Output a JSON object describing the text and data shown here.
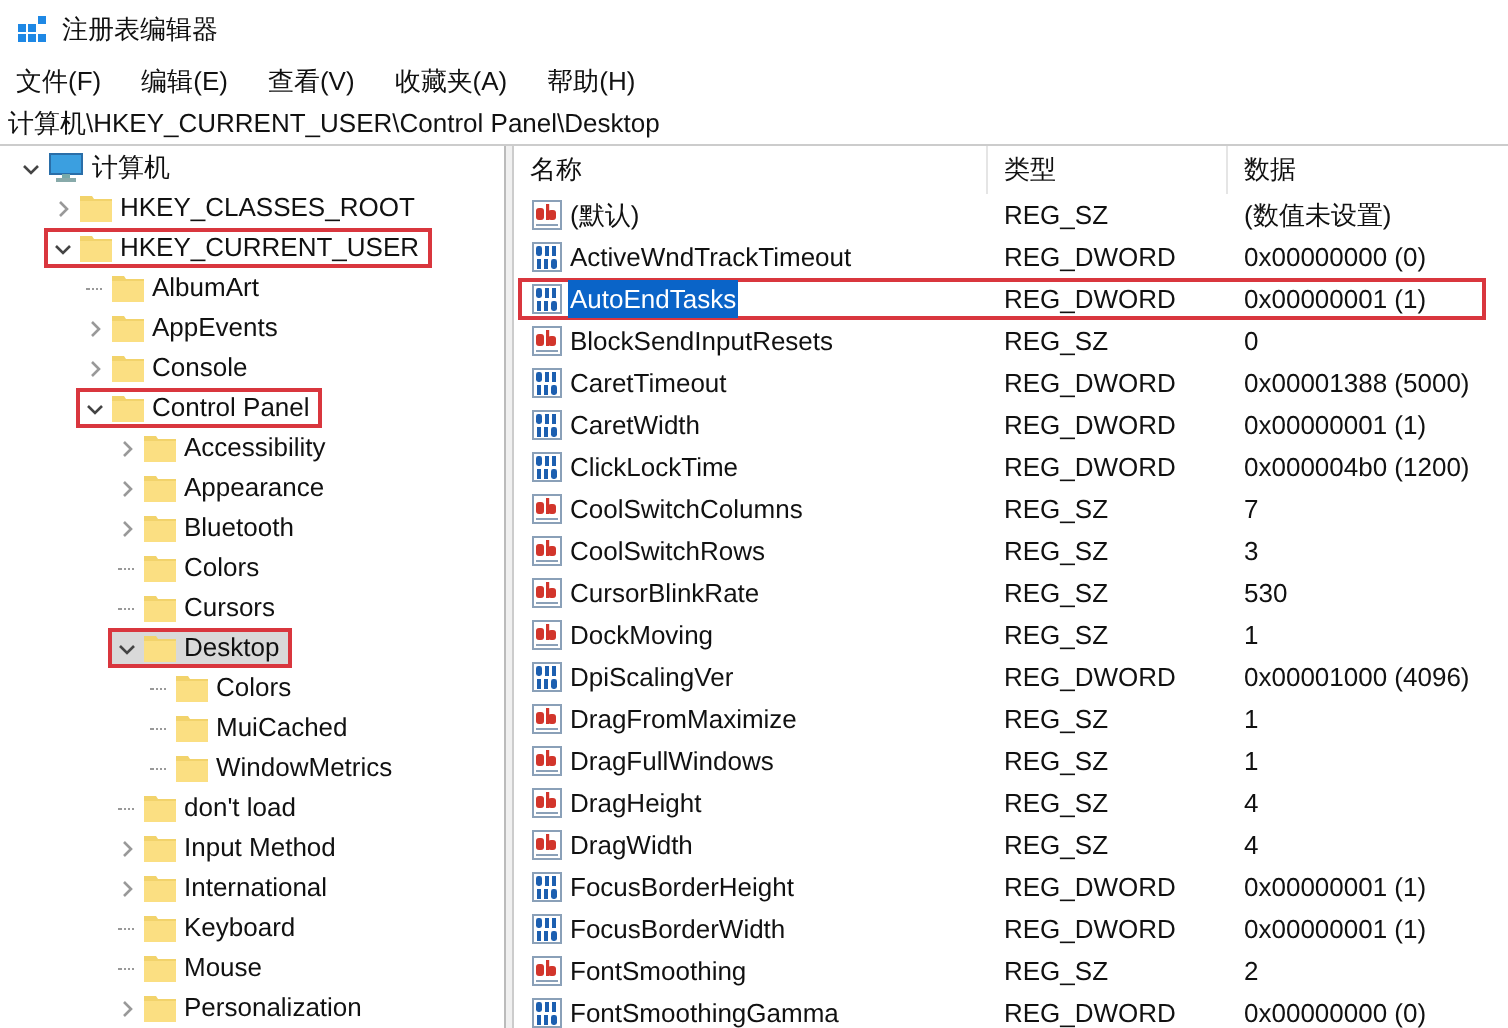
{
  "window": {
    "title": "注册表编辑器"
  },
  "menu": [
    "文件(F)",
    "编辑(E)",
    "查看(V)",
    "收藏夹(A)",
    "帮助(H)"
  ],
  "address": "计算机\\HKEY_CURRENT_USER\\Control Panel\\Desktop",
  "tree": [
    {
      "label": "计算机",
      "kind": "computer",
      "expanded": true,
      "selected": false,
      "highlighted": false,
      "children": [
        {
          "label": "HKEY_CLASSES_ROOT",
          "kind": "branch",
          "expanded": false,
          "selected": false,
          "highlighted": false
        },
        {
          "label": "HKEY_CURRENT_USER",
          "kind": "branch",
          "expanded": true,
          "selected": false,
          "highlighted": true,
          "children": [
            {
              "label": "AlbumArt",
              "kind": "leaf",
              "selected": false,
              "highlighted": false
            },
            {
              "label": "AppEvents",
              "kind": "branch",
              "expanded": false,
              "selected": false,
              "highlighted": false
            },
            {
              "label": "Console",
              "kind": "branch",
              "expanded": false,
              "selected": false,
              "highlighted": false
            },
            {
              "label": "Control Panel",
              "kind": "branch",
              "expanded": true,
              "selected": false,
              "highlighted": true,
              "children": [
                {
                  "label": "Accessibility",
                  "kind": "branch",
                  "expanded": false,
                  "selected": false,
                  "highlighted": false
                },
                {
                  "label": "Appearance",
                  "kind": "branch",
                  "expanded": false,
                  "selected": false,
                  "highlighted": false
                },
                {
                  "label": "Bluetooth",
                  "kind": "branch",
                  "expanded": false,
                  "selected": false,
                  "highlighted": false
                },
                {
                  "label": "Colors",
                  "kind": "leaf",
                  "selected": false,
                  "highlighted": false
                },
                {
                  "label": "Cursors",
                  "kind": "leaf",
                  "selected": false,
                  "highlighted": false
                },
                {
                  "label": "Desktop",
                  "kind": "branch",
                  "expanded": true,
                  "selected": true,
                  "highlighted": true,
                  "children": [
                    {
                      "label": "Colors",
                      "kind": "leaf",
                      "selected": false,
                      "highlighted": false
                    },
                    {
                      "label": "MuiCached",
                      "kind": "leaf",
                      "selected": false,
                      "highlighted": false
                    },
                    {
                      "label": "WindowMetrics",
                      "kind": "leaf",
                      "selected": false,
                      "highlighted": false
                    }
                  ]
                },
                {
                  "label": "don't load",
                  "kind": "leaf",
                  "selected": false,
                  "highlighted": false
                },
                {
                  "label": "Input Method",
                  "kind": "branch",
                  "expanded": false,
                  "selected": false,
                  "highlighted": false
                },
                {
                  "label": "International",
                  "kind": "branch",
                  "expanded": false,
                  "selected": false,
                  "highlighted": false
                },
                {
                  "label": "Keyboard",
                  "kind": "leaf",
                  "selected": false,
                  "highlighted": false
                },
                {
                  "label": "Mouse",
                  "kind": "leaf",
                  "selected": false,
                  "highlighted": false
                },
                {
                  "label": "Personalization",
                  "kind": "branch",
                  "expanded": false,
                  "selected": false,
                  "highlighted": false
                }
              ]
            }
          ]
        }
      ]
    }
  ],
  "table": {
    "columns": [
      "名称",
      "类型",
      "数据"
    ],
    "rows": [
      {
        "kind": "sz",
        "name": "(默认)",
        "type": "REG_SZ",
        "data": "(数值未设置)",
        "selected": false,
        "highlighted": false
      },
      {
        "kind": "dword",
        "name": "ActiveWndTrackTimeout",
        "type": "REG_DWORD",
        "data": "0x00000000 (0)",
        "selected": false,
        "highlighted": false
      },
      {
        "kind": "dword",
        "name": "AutoEndTasks",
        "type": "REG_DWORD",
        "data": "0x00000001 (1)",
        "selected": true,
        "highlighted": true
      },
      {
        "kind": "sz",
        "name": "BlockSendInputResets",
        "type": "REG_SZ",
        "data": "0",
        "selected": false,
        "highlighted": false
      },
      {
        "kind": "dword",
        "name": "CaretTimeout",
        "type": "REG_DWORD",
        "data": "0x00001388 (5000)",
        "selected": false,
        "highlighted": false
      },
      {
        "kind": "dword",
        "name": "CaretWidth",
        "type": "REG_DWORD",
        "data": "0x00000001 (1)",
        "selected": false,
        "highlighted": false
      },
      {
        "kind": "dword",
        "name": "ClickLockTime",
        "type": "REG_DWORD",
        "data": "0x000004b0 (1200)",
        "selected": false,
        "highlighted": false
      },
      {
        "kind": "sz",
        "name": "CoolSwitchColumns",
        "type": "REG_SZ",
        "data": "7",
        "selected": false,
        "highlighted": false
      },
      {
        "kind": "sz",
        "name": "CoolSwitchRows",
        "type": "REG_SZ",
        "data": "3",
        "selected": false,
        "highlighted": false
      },
      {
        "kind": "sz",
        "name": "CursorBlinkRate",
        "type": "REG_SZ",
        "data": "530",
        "selected": false,
        "highlighted": false
      },
      {
        "kind": "sz",
        "name": "DockMoving",
        "type": "REG_SZ",
        "data": "1",
        "selected": false,
        "highlighted": false
      },
      {
        "kind": "dword",
        "name": "DpiScalingVer",
        "type": "REG_DWORD",
        "data": "0x00001000 (4096)",
        "selected": false,
        "highlighted": false
      },
      {
        "kind": "sz",
        "name": "DragFromMaximize",
        "type": "REG_SZ",
        "data": "1",
        "selected": false,
        "highlighted": false
      },
      {
        "kind": "sz",
        "name": "DragFullWindows",
        "type": "REG_SZ",
        "data": "1",
        "selected": false,
        "highlighted": false
      },
      {
        "kind": "sz",
        "name": "DragHeight",
        "type": "REG_SZ",
        "data": "4",
        "selected": false,
        "highlighted": false
      },
      {
        "kind": "sz",
        "name": "DragWidth",
        "type": "REG_SZ",
        "data": "4",
        "selected": false,
        "highlighted": false
      },
      {
        "kind": "dword",
        "name": "FocusBorderHeight",
        "type": "REG_DWORD",
        "data": "0x00000001 (1)",
        "selected": false,
        "highlighted": false
      },
      {
        "kind": "dword",
        "name": "FocusBorderWidth",
        "type": "REG_DWORD",
        "data": "0x00000001 (1)",
        "selected": false,
        "highlighted": false
      },
      {
        "kind": "sz",
        "name": "FontSmoothing",
        "type": "REG_SZ",
        "data": "2",
        "selected": false,
        "highlighted": false
      },
      {
        "kind": "dword",
        "name": "FontSmoothingGamma",
        "type": "REG_DWORD",
        "data": "0x00000000 (0)",
        "selected": false,
        "highlighted": false
      }
    ]
  }
}
